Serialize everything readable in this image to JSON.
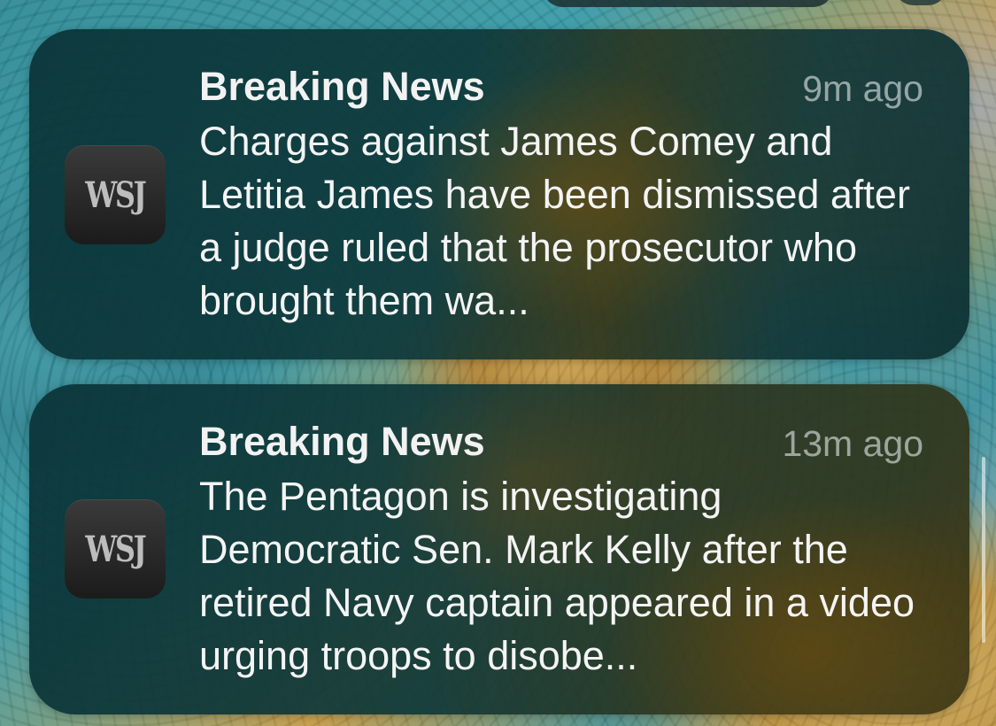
{
  "notifications": [
    {
      "app_icon_text": "WSJ",
      "title": "Breaking News",
      "time": "9m ago",
      "body": "Charges against James Comey and Letitia James have been dismissed after a judge ruled that the prosecutor who brought them wa..."
    },
    {
      "app_icon_text": "WSJ",
      "title": "Breaking News",
      "time": "13m ago",
      "body": "The Pentagon is investigating Democratic Sen. Mark Kelly after the retired Navy captain appeared in a video urging troops to disobe..."
    }
  ],
  "colors": {
    "card_background": "#0e3a3c",
    "title_text": "#f2f2f2",
    "time_text": "#c9d0d0",
    "wsj_icon": "#1b1b1b"
  }
}
